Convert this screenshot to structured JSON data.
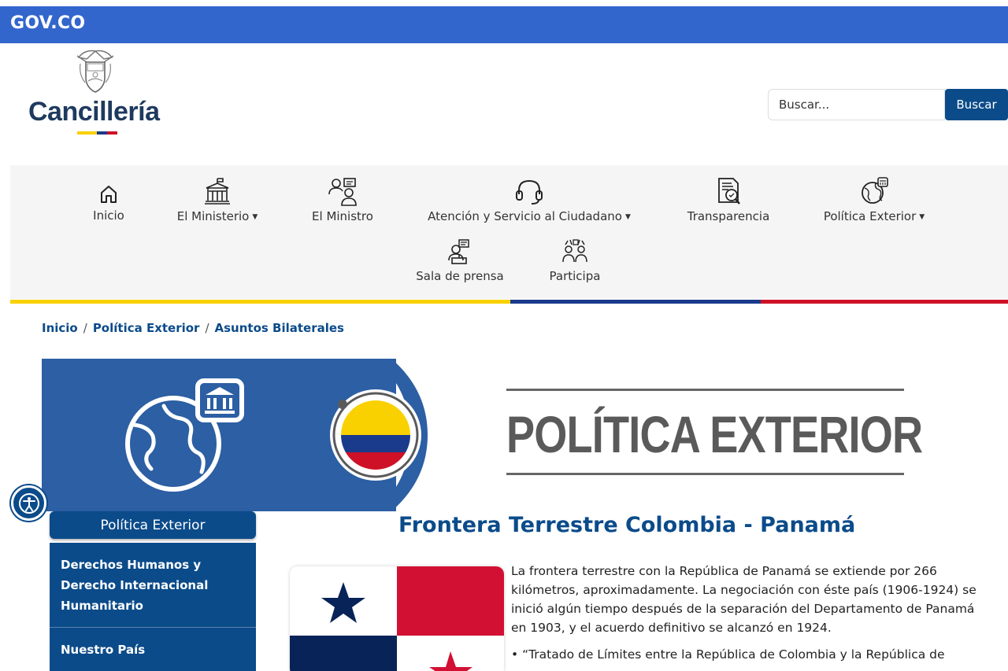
{
  "gov_bar": {
    "logo": "GOV.CO"
  },
  "header": {
    "brand": "Cancillería"
  },
  "search": {
    "placeholder": "Buscar...",
    "button": "Buscar"
  },
  "nav": [
    {
      "label": "Inicio",
      "icon": "home-icon",
      "dropdown": false
    },
    {
      "label": "El Ministerio",
      "icon": "building-icon",
      "dropdown": true
    },
    {
      "label": "El Ministro",
      "icon": "people-icon",
      "dropdown": false
    },
    {
      "label": "Atención y Servicio al Ciudadano",
      "icon": "headset-icon",
      "dropdown": true
    },
    {
      "label": "Transparencia",
      "icon": "document-search-icon",
      "dropdown": false
    },
    {
      "label": "Política Exterior",
      "icon": "globe-icon",
      "dropdown": true
    },
    {
      "label": "Sala de prensa",
      "icon": "press-icon",
      "dropdown": false
    },
    {
      "label": "Participa",
      "icon": "participation-icon",
      "dropdown": false
    }
  ],
  "breadcrumb": [
    "Inicio",
    "Política Exterior",
    "Asuntos Bilaterales"
  ],
  "banner": {
    "title": "POLÍTICA EXTERIOR"
  },
  "sidebar": {
    "title": "Política Exterior",
    "items": [
      "Derechos Humanos y Derecho Internacional Humanitario",
      "Nuestro País"
    ]
  },
  "article": {
    "title": "Frontera Terrestre Colombia - Panamá",
    "paragraphs": [
      "La frontera terrestre con la República de Panamá se extiende por 266 kilómetros, aproximadamente. La negociación con éste país (1906-1924) se inició algún tiempo después de la separación del Departamento de Panamá en 1903, y el acuerdo definitivo se alcanzó en 1924.",
      "• “Tratado de Límites entre la República de Colombia y la República de"
    ]
  },
  "colors": {
    "gov_blue": "#3366cc",
    "primary": "#0b4b8a",
    "flag_yellow": "#f9d100",
    "flag_blue": "#1a3a8c",
    "flag_red": "#ce1126"
  }
}
